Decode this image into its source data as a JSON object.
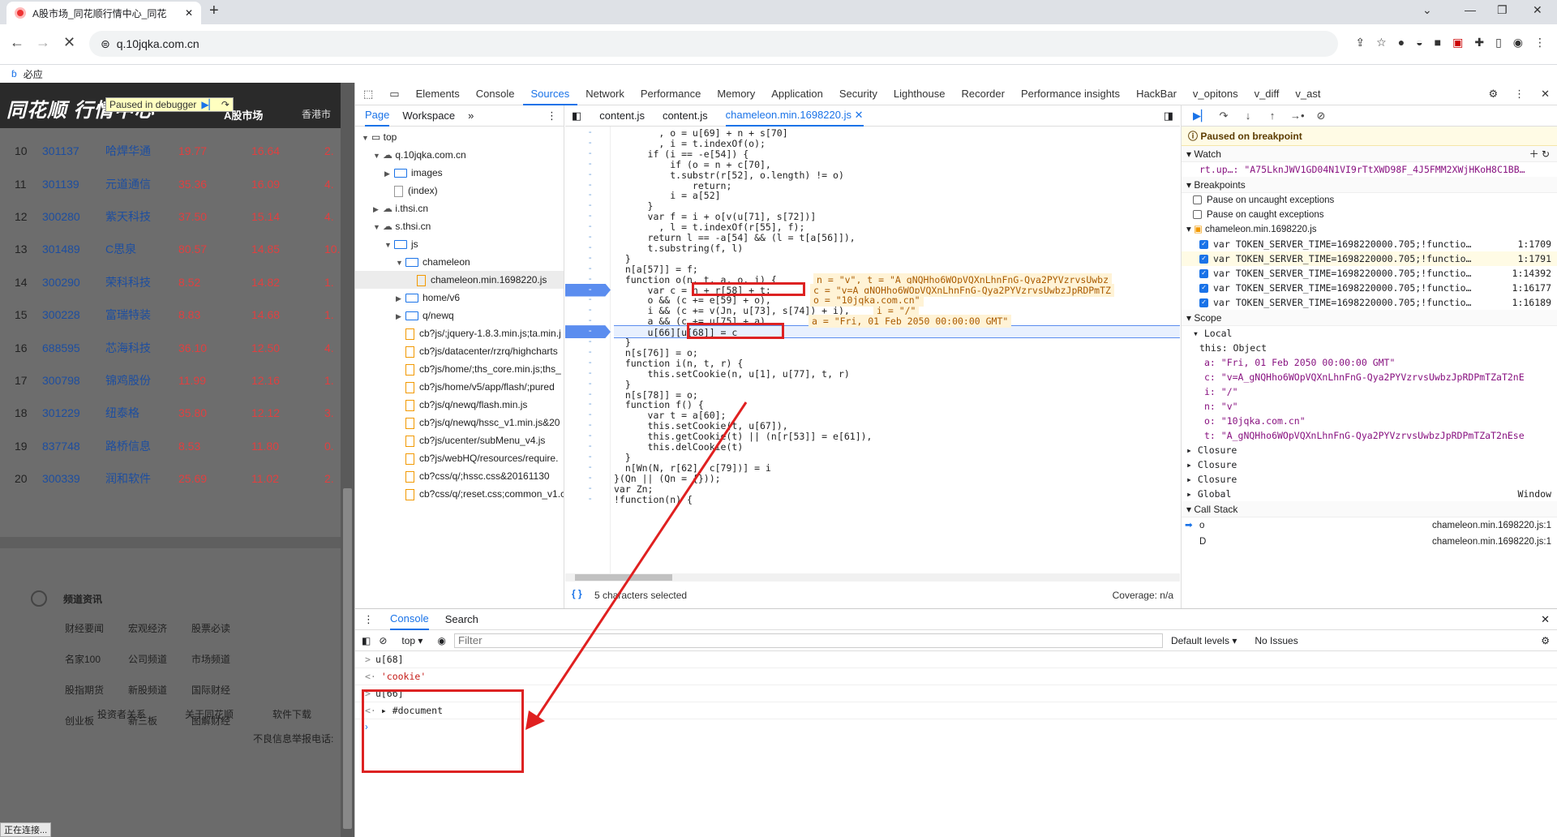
{
  "browser": {
    "tab_title": "A股市场_同花顺行情中心_同花",
    "url": "q.10jqka.com.cn",
    "bookmark": "必应"
  },
  "site": {
    "logo": "同花顺 行情中心",
    "nav_active": "A股市场",
    "nav_next": "香港市",
    "pause_label": "Paused in debugger",
    "rows": [
      {
        "n": "10",
        "code": "301137",
        "name": "哈焊华通",
        "p1": "19.77",
        "p2": "16.64",
        "p3": "2."
      },
      {
        "n": "11",
        "code": "301139",
        "name": "元道通信",
        "p1": "35.36",
        "p2": "16.09",
        "p3": "4."
      },
      {
        "n": "12",
        "code": "300280",
        "name": "紫天科技",
        "p1": "37.50",
        "p2": "15.14",
        "p3": "4."
      },
      {
        "n": "13",
        "code": "301489",
        "name": "C思泉",
        "p1": "80.57",
        "p2": "14.85",
        "p3": "10."
      },
      {
        "n": "14",
        "code": "300290",
        "name": "荣科科技",
        "p1": "8.52",
        "p2": "14.82",
        "p3": "1."
      },
      {
        "n": "15",
        "code": "300228",
        "name": "富瑞特装",
        "p1": "8.83",
        "p2": "14.68",
        "p3": "1."
      },
      {
        "n": "16",
        "code": "688595",
        "name": "芯海科技",
        "p1": "36.10",
        "p2": "12.50",
        "p3": "4."
      },
      {
        "n": "17",
        "code": "300798",
        "name": "锦鸡股份",
        "p1": "11.99",
        "p2": "12.16",
        "p3": "1."
      },
      {
        "n": "18",
        "code": "301229",
        "name": "纽泰格",
        "p1": "35.80",
        "p2": "12.12",
        "p3": "3."
      },
      {
        "n": "19",
        "code": "837748",
        "name": "路桥信息",
        "p1": "8.53",
        "p2": "11.80",
        "p3": "0."
      },
      {
        "n": "20",
        "code": "300339",
        "name": "润和软件",
        "p1": "25.69",
        "p2": "11.02",
        "p3": "2."
      }
    ],
    "footer_head": "频道资讯",
    "footer_links": [
      "财经要闻",
      "宏观经济",
      "股票必读",
      "名家100",
      "公司频道",
      "市场频道",
      "股指期货",
      "新股频道",
      "国际财经",
      "创业板",
      "新三板",
      "图解财经"
    ],
    "bottom_links": [
      "投资者关系",
      "关于同花顺",
      "软件下载"
    ],
    "report": "不良信息举报电话:",
    "status": "正在连接..."
  },
  "devtools": {
    "tabs": [
      "Elements",
      "Console",
      "Sources",
      "Network",
      "Performance",
      "Memory",
      "Application",
      "Security",
      "Lighthouse",
      "Recorder",
      "Performance insights",
      "HackBar",
      "v_opitons",
      "v_diff",
      "v_ast"
    ],
    "nav_tabs": [
      "Page",
      "Workspace"
    ],
    "tree": [
      {
        "lv": 0,
        "t": "top",
        "k": "win"
      },
      {
        "lv": 1,
        "t": "q.10jqka.com.cn",
        "k": "cloud"
      },
      {
        "lv": 2,
        "t": "images",
        "k": "dir"
      },
      {
        "lv": 2,
        "t": "(index)",
        "k": "doc"
      },
      {
        "lv": 1,
        "t": "i.thsi.cn",
        "k": "cloud"
      },
      {
        "lv": 1,
        "t": "s.thsi.cn",
        "k": "cloud"
      },
      {
        "lv": 2,
        "t": "js",
        "k": "dir"
      },
      {
        "lv": 3,
        "t": "chameleon",
        "k": "dir"
      },
      {
        "lv": 4,
        "t": "chameleon.min.1698220.js",
        "k": "file",
        "sel": true
      },
      {
        "lv": 3,
        "t": "home/v6",
        "k": "dir"
      },
      {
        "lv": 3,
        "t": "q/newq",
        "k": "dir"
      },
      {
        "lv": 3,
        "t": "cb?js/;jquery-1.8.3.min.js;ta.min.j",
        "k": "file"
      },
      {
        "lv": 3,
        "t": "cb?js/datacenter/rzrq/highcharts",
        "k": "file"
      },
      {
        "lv": 3,
        "t": "cb?js/home/;ths_core.min.js;ths_",
        "k": "file"
      },
      {
        "lv": 3,
        "t": "cb?js/home/v5/app/flash/;pured",
        "k": "file"
      },
      {
        "lv": 3,
        "t": "cb?js/q/newq/flash.min.js",
        "k": "file"
      },
      {
        "lv": 3,
        "t": "cb?js/q/newq/hssc_v1.min.js&20",
        "k": "file"
      },
      {
        "lv": 3,
        "t": "cb?js/ucenter/subMenu_v4.js",
        "k": "file"
      },
      {
        "lv": 3,
        "t": "cb?js/webHQ/resources/require.",
        "k": "file"
      },
      {
        "lv": 3,
        "t": "cb?css/q/;hssc.css&20161130",
        "k": "file"
      },
      {
        "lv": 3,
        "t": "cb?css/q/;reset.css;common_v1.c",
        "k": "file"
      }
    ],
    "editor_tabs": [
      "content.js",
      "content.js",
      "chameleon.min.1698220.js"
    ],
    "code": [
      "        , o = u[69] + n + s[70]",
      "        , i = t.indexOf(o);",
      "      if (i == -e[54]) {",
      "          if (o = n + c[70],",
      "          t.substr(r[52], o.length) != o)",
      "              return;",
      "          i = a[52]",
      "      }",
      "      var f = i + o[v(u[71], s[72])]",
      "        , l = t.indexOf(r[55], f);",
      "      return l == -a[54] && (l = t[a[56]]),",
      "      t.substring(f, l)",
      "  }",
      "  n[a[57]] = f;",
      "  function o(n, t, a, o, i) {",
      "      var c = n + r[58] + t;",
      "      o && (c += e[59] + o),",
      "      i && (c += v(Jn, u[73], s[74]) + i),",
      "      a && (c += u[75] + a),",
      "      u[66][u[68]] = c",
      "  }",
      "  n[s[76]] = o;",
      "  function i(n, t, r) {",
      "      this.setCookie(n, u[1], u[77], t, r)",
      "  }",
      "  n[s[78]] = o;",
      "  function f() {",
      "      var t = a[60];",
      "      this.setCookie(t, u[67]),",
      "      this.getCookie(t) || (n[r[53]] = e[61]),",
      "      this.delCookie(t)",
      "  }",
      "  n[Wn(N, r[62], c[79])] = i",
      "}(Qn || (Qn = {}));",
      "var Zn;",
      "!function(n) {"
    ],
    "inline_vals": [
      "n = \"v\", t = \"A_gNQHho6WOpVQXnLhnFnG-Qya2PYVzrvsUwbz",
      "c = \"v=A_gNQHho6WOpVQXnLhnFnG-Qya2PYVzrvsUwbzJpRDPmTZ",
      "o = \"10jqka.com.cn\"",
      "i = \"/\"",
      "a = \"Fri, 01 Feb 2050 00:00:00 GMT\""
    ],
    "editor_status": "5 characters selected",
    "coverage": "Coverage: n/a",
    "paused": "Paused on breakpoint",
    "watch_label": "Watch",
    "watch_expr": "rt.up…: \"A75LknJWV1GD04N1VI9rTtXWD98F_4J5FMM2XWjHKoH8C1BB…",
    "breakpoints_label": "Breakpoints",
    "bp_opts": [
      "Pause on uncaught exceptions",
      "Pause on caught exceptions"
    ],
    "bp_file": "chameleon.min.1698220.js",
    "bp_lines": [
      {
        "code": "var TOKEN_SERVER_TIME=1698220000.705;!functio…",
        "loc": "1:1709"
      },
      {
        "code": "var TOKEN_SERVER_TIME=1698220000.705;!functio…",
        "loc": "1:1791"
      },
      {
        "code": "var TOKEN_SERVER_TIME=1698220000.705;!functio…",
        "loc": "1:14392"
      },
      {
        "code": "var TOKEN_SERVER_TIME=1698220000.705;!functio…",
        "loc": "1:16177"
      },
      {
        "code": "var TOKEN_SERVER_TIME=1698220000.705;!functio…",
        "loc": "1:16189"
      }
    ],
    "scope_label": "Scope",
    "local_label": "Local",
    "scope_vars": [
      "this: Object",
      "a: \"Fri, 01 Feb 2050 00:00:00 GMT\"",
      "c: \"v=A_gNQHho6WOpVQXnLhnFnG-Qya2PYVzrvsUwbzJpRDPmTZaT2nE",
      "i: \"/\"",
      "n: \"v\"",
      "o: \"10jqka.com.cn\"",
      "t: \"A_gNQHho6WOpVQXnLhnFnG-Qya2PYVzrvsUwbzJpRDPmTZaT2nEse"
    ],
    "closures": [
      "Closure",
      "Closure",
      "Closure"
    ],
    "global": "Global",
    "global_val": "Window",
    "callstack_label": "Call Stack",
    "frames": [
      {
        "fn": "o",
        "loc": "chameleon.min.1698220.js:1"
      },
      {
        "fn": "D",
        "loc": "chameleon.min.1698220.js:1"
      }
    ],
    "drawer_tabs": [
      "Console",
      "Search"
    ],
    "context": "top",
    "filter_ph": "Filter",
    "levels": "Default levels",
    "issues": "No Issues",
    "console": [
      {
        "p": ">",
        "t": "u[68]",
        "c": "#222"
      },
      {
        "p": "<·",
        "t": "'cookie'",
        "c": "#c41a16"
      },
      {
        "p": ">",
        "t": "u[66]",
        "c": "#222"
      },
      {
        "p": "<·",
        "t": "▸ #document",
        "c": "#222"
      }
    ]
  }
}
